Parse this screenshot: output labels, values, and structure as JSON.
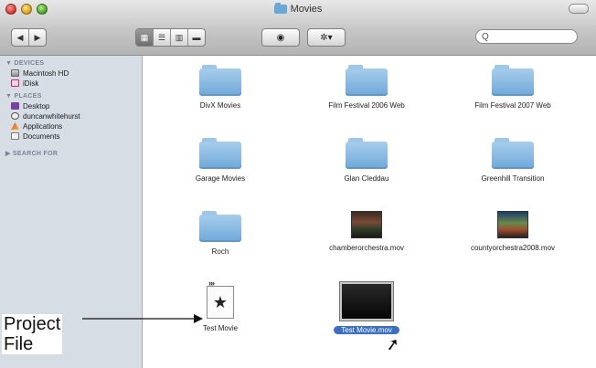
{
  "window": {
    "title": "Movies"
  },
  "toolbar": {
    "search_placeholder": "Q"
  },
  "sidebar": {
    "sections": [
      {
        "heading": "▼ DEVICES",
        "items": [
          "Macintosh HD",
          "iDisk"
        ]
      },
      {
        "heading": "▼ PLACES",
        "items": [
          "Desktop",
          "duncanwhitehurst",
          "Applications",
          "Documents"
        ]
      },
      {
        "heading": "▶ SEARCH FOR",
        "items": []
      }
    ]
  },
  "files": [
    {
      "label": "DivX Movies",
      "icon": "folder-icon"
    },
    {
      "label": "Film Festival 2006 Web",
      "icon": "folder-icon"
    },
    {
      "label": "Film Festival 2007 Web",
      "icon": "folder-icon"
    },
    {
      "label": "Garage Movies",
      "icon": "folder-icon"
    },
    {
      "label": "Glan Cleddau",
      "icon": "folder-icon"
    },
    {
      "label": "Greenhill Transition",
      "icon": "folder-icon"
    },
    {
      "label": "Roch",
      "icon": "folder-icon"
    },
    {
      "label": "chamberorchestra.mov",
      "icon": "movie-thumbnail"
    },
    {
      "label": "countyorchestra2008.mov",
      "icon": "movie-thumbnail"
    },
    {
      "label": "Test Movie",
      "icon": "project-file-icon"
    },
    {
      "label": "Test Movie.mov",
      "icon": "movie-thumbnail",
      "selected": true
    }
  ],
  "annotation": {
    "line1": "Project",
    "line2": "File"
  },
  "colors": {
    "selection": "#3a6fc4",
    "sidebar_bg": "#d6dde5",
    "folder": "#6fa8d8"
  }
}
